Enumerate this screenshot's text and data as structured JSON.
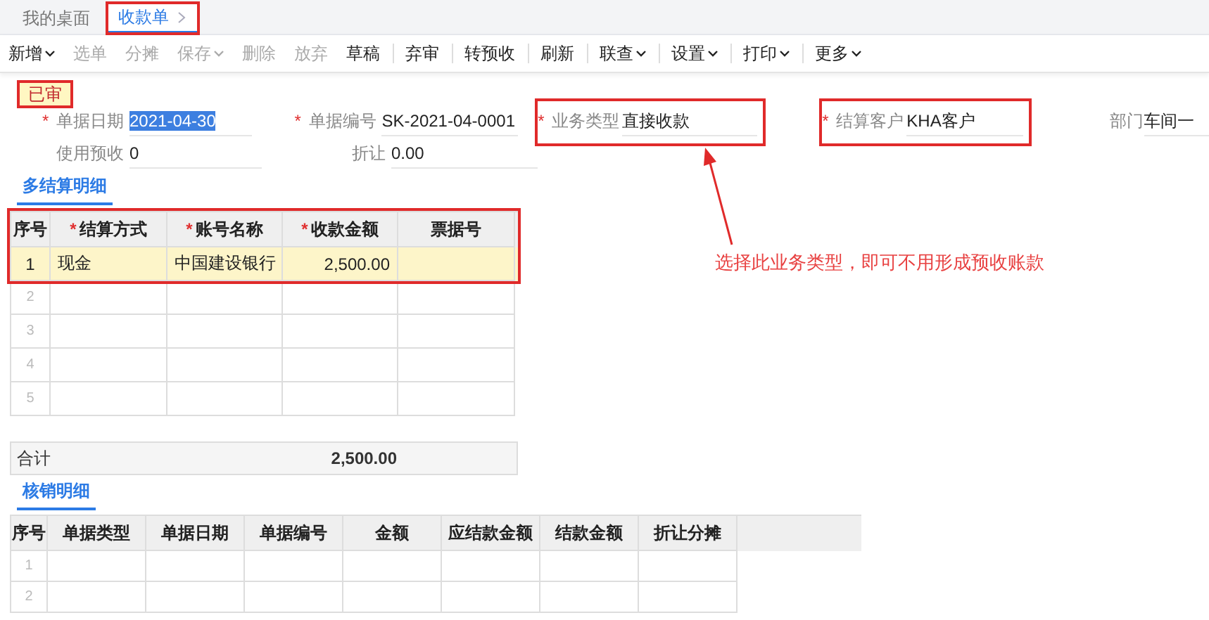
{
  "tabs": [
    {
      "label": "我的桌面",
      "selected": false,
      "highlighted": false,
      "closable": false
    },
    {
      "label": "收款单",
      "selected": true,
      "highlighted": true,
      "closable": true
    }
  ],
  "toolbar": [
    {
      "label": "新增",
      "disabled": false,
      "dropdown": true,
      "separator": false
    },
    {
      "label": "选单",
      "disabled": true,
      "dropdown": false,
      "separator": false
    },
    {
      "label": "分摊",
      "disabled": true,
      "dropdown": false,
      "separator": false
    },
    {
      "label": "保存",
      "disabled": true,
      "dropdown": true,
      "separator": false
    },
    {
      "label": "删除",
      "disabled": true,
      "dropdown": false,
      "separator": false
    },
    {
      "label": "放弃",
      "disabled": true,
      "dropdown": false,
      "separator": false
    },
    {
      "label": "草稿",
      "disabled": false,
      "dropdown": false,
      "separator": true
    },
    {
      "label": "弃审",
      "disabled": false,
      "dropdown": false,
      "separator": true
    },
    {
      "label": "转预收",
      "disabled": false,
      "dropdown": false,
      "separator": true
    },
    {
      "label": "刷新",
      "disabled": false,
      "dropdown": false,
      "separator": true
    },
    {
      "label": "联查",
      "disabled": false,
      "dropdown": true,
      "separator": true
    },
    {
      "label": "设置",
      "disabled": false,
      "dropdown": true,
      "separator": true
    },
    {
      "label": "打印",
      "disabled": false,
      "dropdown": true,
      "separator": true
    },
    {
      "label": "更多",
      "disabled": false,
      "dropdown": true,
      "separator": false
    }
  ],
  "status": {
    "label": "已审",
    "highlighted": true
  },
  "form_rows": [
    [
      {
        "label": "单据日期",
        "value": "2021-04-30",
        "required": "*",
        "highlighted": false,
        "selected": true
      },
      {
        "label": "单据编号",
        "value": "SK-2021-04-0001",
        "required": "*",
        "highlighted": false,
        "selected": false
      },
      {
        "label": "业务类型",
        "value": "直接收款",
        "required": "*",
        "highlighted": true,
        "selected": false
      },
      {
        "label": "结算客户",
        "value": "KHA客户",
        "required": "*",
        "highlighted": true,
        "selected": false
      },
      {
        "label": "部门",
        "value": "车间一",
        "highlighted": false,
        "selected": false
      }
    ],
    [
      {
        "label": "使用预收",
        "value": "0",
        "highlighted": false,
        "selected": false
      },
      {
        "label": "折让",
        "value": "0.00",
        "highlighted": false,
        "selected": false
      }
    ]
  ],
  "settlement": {
    "title": "多结算明细",
    "highlighted": true,
    "columns": [
      {
        "label": "序号"
      },
      {
        "label": "结算方式",
        "required": "*"
      },
      {
        "label": "账号名称",
        "required": "*"
      },
      {
        "label": "收款金额",
        "required": "*"
      },
      {
        "label": "票据号"
      }
    ],
    "rows": [
      {
        "no": "1",
        "selected": true,
        "method": "现金",
        "account": "中国建设银行",
        "amount": "2,500.00"
      },
      {
        "no": "2",
        "selected": false
      },
      {
        "no": "3",
        "selected": false
      },
      {
        "no": "4",
        "selected": false
      },
      {
        "no": "5",
        "selected": false
      }
    ],
    "total_label": "合计",
    "total": "2,500.00"
  },
  "writeoff": {
    "title": "核销明细",
    "columns": [
      "序号",
      "单据类型",
      "单据日期",
      "单据编号",
      "金额",
      "应结款金额",
      "结款金额",
      "折让分摊"
    ],
    "rows": [
      {
        "no": "1"
      },
      {
        "no": "2"
      }
    ]
  },
  "annotation": {
    "note": "选择此业务类型，即可不用形成预收账款"
  }
}
